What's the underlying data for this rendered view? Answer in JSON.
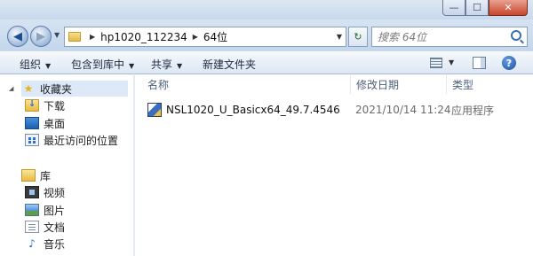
{
  "window": {
    "minimize_symbol": "—",
    "maximize_symbol": "☐",
    "close_symbol": "✕"
  },
  "address": {
    "back_symbol": "◀",
    "forward_symbol": "▶",
    "crumbs": [
      "hp1020_112234",
      "64位"
    ],
    "refresh_symbol": "↻",
    "search_placeholder": "搜索 64位"
  },
  "toolbar": {
    "organize": "组织",
    "include_in_library": "包含到库中",
    "share": "共享",
    "new_folder": "新建文件夹",
    "dropdown_symbol": "▼",
    "help_symbol": "?"
  },
  "sidebar": {
    "favorites": {
      "label": "收藏夹",
      "items": [
        {
          "label": "下载",
          "icon": "download-folder-icon"
        },
        {
          "label": "桌面",
          "icon": "desktop-icon"
        },
        {
          "label": "最近访问的位置",
          "icon": "recent-places-icon"
        }
      ]
    },
    "libraries": {
      "label": "库",
      "items": [
        {
          "label": "视频",
          "icon": "video-library-icon"
        },
        {
          "label": "图片",
          "icon": "pictures-library-icon"
        },
        {
          "label": "文档",
          "icon": "documents-library-icon"
        },
        {
          "label": "音乐",
          "icon": "music-library-icon"
        }
      ]
    }
  },
  "files": {
    "columns": {
      "name": "名称",
      "modified": "修改日期",
      "type": "类型"
    },
    "rows": [
      {
        "name": "NSL1020_U_Basicx64_49.7.4546",
        "modified": "2021/10/14 11:24",
        "type": "应用程序",
        "icon": "application-exe-icon"
      }
    ]
  }
}
